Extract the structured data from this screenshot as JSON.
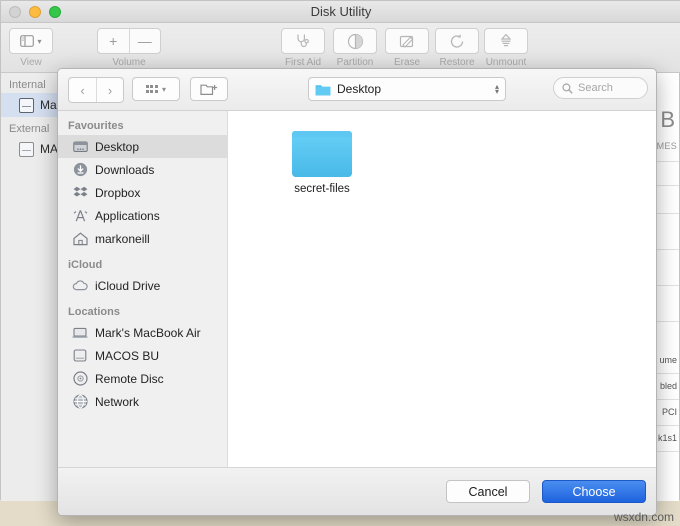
{
  "window": {
    "title": "Disk Utility",
    "traffic_lights": [
      "close",
      "minimize",
      "maximize"
    ]
  },
  "toolbar": {
    "view": {
      "label": "View",
      "icon": "sidebar-icon"
    },
    "volume": {
      "label": "Volume",
      "add": "+",
      "remove": "—"
    },
    "tools": [
      {
        "label": "First Aid",
        "icon": "stethoscope-icon",
        "enabled": false
      },
      {
        "label": "Partition",
        "icon": "pie-chart-icon",
        "enabled": false
      },
      {
        "label": "Erase",
        "icon": "erase-icon",
        "enabled": false
      },
      {
        "label": "Restore",
        "icon": "restore-icon",
        "enabled": false
      },
      {
        "label": "Unmount",
        "icon": "eject-icon",
        "enabled": false
      }
    ]
  },
  "disk_sidebar": {
    "sections": [
      {
        "header": "Internal",
        "items": [
          {
            "label": "Ma",
            "selected": true
          }
        ]
      },
      {
        "header": "External",
        "items": [
          {
            "label": "MA",
            "selected": false
          }
        ]
      }
    ]
  },
  "disk_main": {
    "big_title": "B",
    "subtitle": "UMES",
    "clipped_lines": [
      "ume",
      "bled",
      "PCI",
      "k1s1"
    ]
  },
  "sheet": {
    "nav": {
      "back": "‹",
      "forward": "›"
    },
    "view_toggle": {
      "icon": "grid-view-icon",
      "chevron": "▾"
    },
    "new_folder": {
      "icon": "new-folder-icon"
    },
    "path_popup": {
      "label": "Desktop",
      "icon": "folder-icon"
    },
    "search": {
      "placeholder": "Search",
      "icon": "search-icon"
    },
    "sidebar": {
      "sections": [
        {
          "header": "Favourites",
          "items": [
            {
              "label": "Desktop",
              "icon": "desktop-icon",
              "selected": true
            },
            {
              "label": "Downloads",
              "icon": "downloads-icon",
              "selected": false
            },
            {
              "label": "Dropbox",
              "icon": "dropbox-icon",
              "selected": false
            },
            {
              "label": "Applications",
              "icon": "applications-icon",
              "selected": false
            },
            {
              "label": "markoneill",
              "icon": "home-icon",
              "selected": false
            }
          ]
        },
        {
          "header": "iCloud",
          "items": [
            {
              "label": "iCloud Drive",
              "icon": "cloud-icon",
              "selected": false
            }
          ]
        },
        {
          "header": "Locations",
          "items": [
            {
              "label": "Mark's MacBook Air",
              "icon": "laptop-icon",
              "selected": false
            },
            {
              "label": "MACOS BU",
              "icon": "harddrive-icon",
              "selected": false
            },
            {
              "label": "Remote Disc",
              "icon": "disc-icon",
              "selected": false
            },
            {
              "label": "Network",
              "icon": "globe-icon",
              "selected": false
            }
          ]
        }
      ]
    },
    "files": [
      {
        "name": "secret-files",
        "type": "folder",
        "color": "#5ec8f2"
      }
    ],
    "footer": {
      "cancel_label": "Cancel",
      "choose_label": "Choose"
    }
  },
  "watermark": "wsxdn.com",
  "colors": {
    "accent_blue": "#1f63df",
    "folder_blue": "#5ec8f2",
    "selection_blue": "#d4dff0",
    "sidebar_selection": "#dcdcdc"
  }
}
